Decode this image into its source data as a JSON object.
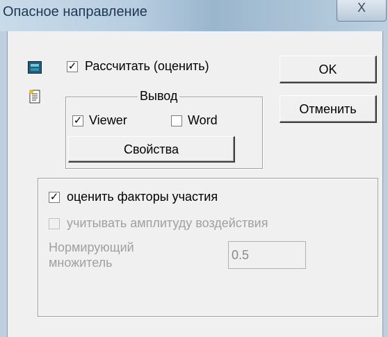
{
  "window": {
    "title": "Опасное направление",
    "close_glyph": "X"
  },
  "calculate": {
    "checked": true,
    "label": "Рассчитать (оценить)"
  },
  "output_group": {
    "legend": "Вывод",
    "viewer": {
      "checked": true,
      "label": "Viewer"
    },
    "word": {
      "checked": false,
      "label": "Word"
    },
    "properties_label": "Свойства"
  },
  "buttons": {
    "ok": "OK",
    "cancel": "Отменить"
  },
  "options": {
    "factors": {
      "checked": true,
      "label": "оценить факторы участия"
    },
    "amplitude": {
      "checked": false,
      "enabled": false,
      "label": "учитывать амплитуду воздействия"
    },
    "normalizer_label_line1": "Нормирующий",
    "normalizer_label_line2": "множитель",
    "normalizer_value": "0.5"
  },
  "icons": {
    "calc": "calculator-icon",
    "doc": "document-icon"
  }
}
